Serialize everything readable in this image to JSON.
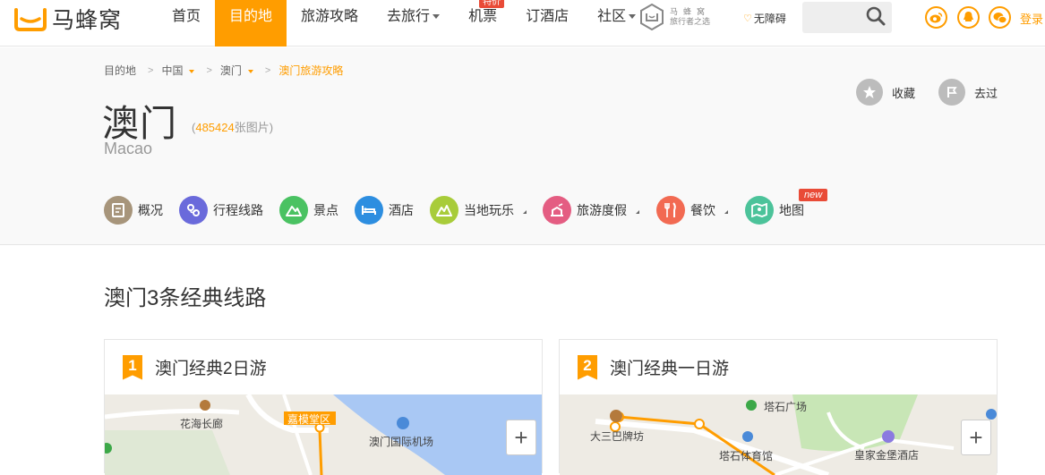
{
  "logo": {
    "text": "马蜂窝"
  },
  "nav": {
    "items": [
      {
        "label": "首页",
        "active": false,
        "dropdown": false
      },
      {
        "label": "目的地",
        "active": true,
        "dropdown": false
      },
      {
        "label": "旅游攻略",
        "active": false,
        "dropdown": false
      },
      {
        "label": "去旅行",
        "active": false,
        "dropdown": true
      },
      {
        "label": "机票",
        "active": false,
        "dropdown": false,
        "badge": "特价"
      },
      {
        "label": "订酒店",
        "active": false,
        "dropdown": false
      },
      {
        "label": "社区",
        "active": false,
        "dropdown": true
      }
    ]
  },
  "brand_seal": {
    "line1": "马蜂窝",
    "line2": "旅行者之选"
  },
  "accessibility": {
    "label": "无障碍"
  },
  "search": {
    "placeholder": ""
  },
  "social": {
    "icons": [
      "weibo-icon",
      "qq-icon",
      "wechat-icon"
    ]
  },
  "login": {
    "label": "登录"
  },
  "breadcrumb": {
    "items": [
      "目的地",
      "中国",
      "澳门",
      "澳门旅游攻略"
    ]
  },
  "destination": {
    "title": "澳门",
    "photo_count_prefix": "(",
    "photo_count": "485424",
    "photo_count_suffix": "张图片)",
    "subtitle": "Macao"
  },
  "actions": {
    "favorite": "收藏",
    "been_there": "去过"
  },
  "tabs": [
    {
      "label": "概况",
      "icon": "overview-icon",
      "color": "#a7957b",
      "dropdown": false
    },
    {
      "label": "行程线路",
      "icon": "route-icon",
      "color": "#6a6adb",
      "dropdown": false
    },
    {
      "label": "景点",
      "icon": "mountain-icon",
      "color": "#4ac262",
      "dropdown": false
    },
    {
      "label": "酒店",
      "icon": "bed-icon",
      "color": "#2d8ee0",
      "dropdown": false
    },
    {
      "label": "当地玩乐",
      "icon": "play-icon",
      "color": "#a8cc3a",
      "dropdown": true
    },
    {
      "label": "旅游度假",
      "icon": "vacation-icon",
      "color": "#e45d82",
      "dropdown": true
    },
    {
      "label": "餐饮",
      "icon": "food-icon",
      "color": "#f26a52",
      "dropdown": true
    },
    {
      "label": "地图",
      "icon": "map-icon",
      "color": "#4cc39a",
      "dropdown": false,
      "badge": "new"
    }
  ],
  "routes_section": {
    "title": "澳门3条经典线路"
  },
  "cards": [
    {
      "number": "1",
      "title": "澳门经典2日游",
      "labels": [
        "花海长廊",
        "嘉模堂区",
        "澳门国际机场"
      ]
    },
    {
      "number": "2",
      "title": "澳门经典一日游",
      "labels": [
        "塔石广场",
        "大三巴牌坊",
        "塔石体育馆",
        "皇家金堡酒店"
      ]
    }
  ],
  "zoom": {
    "plus": "+"
  },
  "colors": {
    "accent": "#ff9d00",
    "badge_red": "#e94b37",
    "bg_header": "#f9f9f9"
  }
}
